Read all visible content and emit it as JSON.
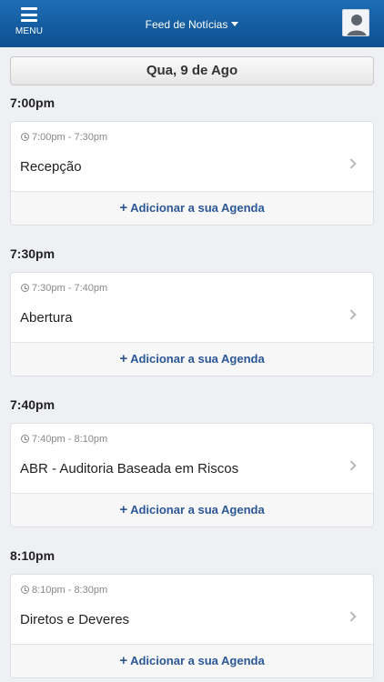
{
  "header": {
    "menu_label": "MENU",
    "title": "Feed de Notícias"
  },
  "date_label": "Qua, 9 de Ago",
  "sessions": [
    {
      "heading": "7:00pm",
      "range": "7:00pm - 7:30pm",
      "title": "Recepção",
      "action": "Adicionar a sua Agenda"
    },
    {
      "heading": "7:30pm",
      "range": "7:30pm - 7:40pm",
      "title": "Abertura",
      "action": "Adicionar a sua Agenda"
    },
    {
      "heading": "7:40pm",
      "range": "7:40pm - 8:10pm",
      "title": "ABR - Auditoria Baseada em Riscos",
      "action": "Adicionar a sua Agenda"
    },
    {
      "heading": "8:10pm",
      "range": "8:10pm - 8:30pm",
      "title": "Diretos e Deveres",
      "action": "Adicionar a sua Agenda"
    }
  ],
  "icons": {
    "menu": "hamburger-icon",
    "title_dropdown": "caret-down-icon",
    "profile": "avatar-icon",
    "time": "clock-icon",
    "more": "chevron-right-icon",
    "add": "plus-icon"
  },
  "colors": {
    "header": "#0d4f8f",
    "link": "#2b5797",
    "background": "#eef0f4"
  }
}
